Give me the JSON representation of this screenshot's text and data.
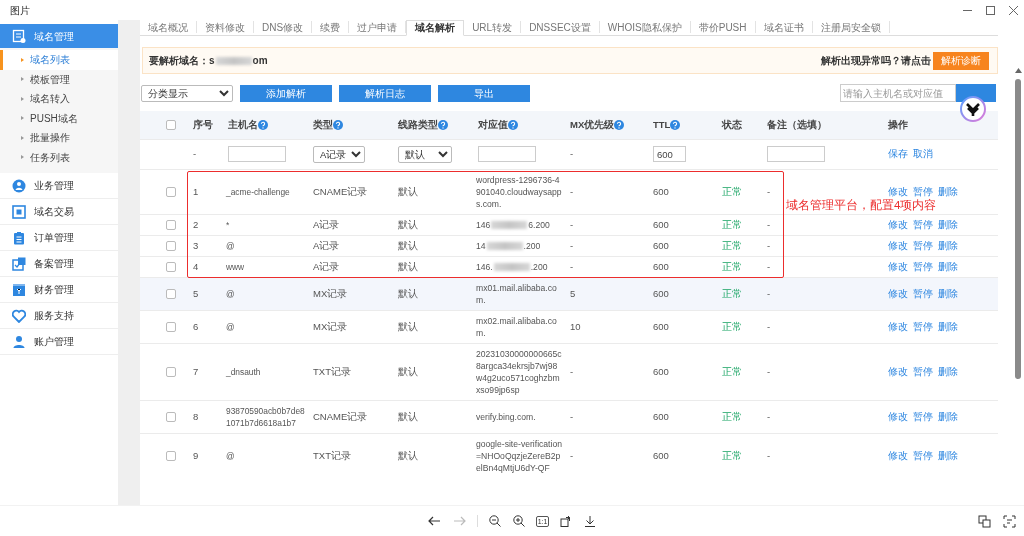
{
  "viewer": {
    "title": "图片",
    "zoom_reset": "1:1",
    "back_disabled": false,
    "forward_disabled": true
  },
  "sidebar": {
    "groups": [
      {
        "label": "域名管理",
        "expanded": true,
        "children": [
          {
            "label": "域名列表",
            "selected": true
          },
          {
            "label": "模板管理",
            "selected": false
          },
          {
            "label": "域名转入",
            "selected": false
          },
          {
            "label": "PUSH域名",
            "selected": false
          },
          {
            "label": "批量操作",
            "selected": false
          },
          {
            "label": "任务列表",
            "selected": false
          }
        ]
      },
      {
        "label": "业务管理",
        "expanded": false
      },
      {
        "label": "域名交易",
        "expanded": false
      },
      {
        "label": "订单管理",
        "expanded": false
      },
      {
        "label": "备案管理",
        "expanded": false
      },
      {
        "label": "财务管理",
        "expanded": false
      },
      {
        "label": "服务支持",
        "expanded": false
      },
      {
        "label": "账户管理",
        "expanded": false
      }
    ]
  },
  "tabs": [
    {
      "label": "域名概况",
      "selected": false
    },
    {
      "label": "资料修改",
      "selected": false
    },
    {
      "label": "DNS修改",
      "selected": false
    },
    {
      "label": "续费",
      "selected": false
    },
    {
      "label": "过户申请",
      "selected": false
    },
    {
      "label": "域名解析",
      "selected": true
    },
    {
      "label": "URL转发",
      "selected": false
    },
    {
      "label": "DNSSEC设置",
      "selected": false
    },
    {
      "label": "WHOIS隐私保护",
      "selected": false
    },
    {
      "label": "带价PUSH",
      "selected": false
    },
    {
      "label": "域名证书",
      "selected": false
    },
    {
      "label": "注册局安全锁",
      "selected": false
    }
  ],
  "notice": {
    "label": "要解析域名：",
    "domain_parts": [
      "s",
      "om"
    ],
    "hint": "解析出现异常吗？请点击",
    "button": "解析诊断"
  },
  "toolbar": {
    "filter": "分类显示",
    "buttons": [
      "添加解析",
      "解析日志",
      "导出"
    ],
    "search": {
      "placeholder": "请输入主机名或对应值"
    }
  },
  "table": {
    "select_all": {
      "checked": false
    },
    "columns": [
      {
        "label": "序号",
        "help": false
      },
      {
        "label": "主机名",
        "help": true
      },
      {
        "label": "类型",
        "help": true
      },
      {
        "label": "线路类型",
        "help": true
      },
      {
        "label": "对应值",
        "help": true
      },
      {
        "label": "MX优先级",
        "help": true
      },
      {
        "label": "TTL",
        "help": true
      },
      {
        "label": "状态",
        "help": false
      },
      {
        "label": "备注（选填）",
        "help": false
      },
      {
        "label": "操作",
        "help": false
      }
    ],
    "new_row": {
      "index": "-",
      "type": "A记录",
      "line": "默认",
      "mx": "-",
      "ttl": "600",
      "actions": [
        "保存",
        "取消"
      ]
    },
    "rows": [
      {
        "checked": false,
        "highlighted": false,
        "boxed": true,
        "index": "1",
        "host": "_acme-challenge",
        "type": "CNAME记录",
        "line": "默认",
        "value": "wordpress-1296736-4901040.cloudwaysapps.com.",
        "mx": "-",
        "ttl": "600",
        "status": "正常",
        "note": "-",
        "actions": [
          "修改",
          "暂停",
          "删除"
        ]
      },
      {
        "checked": false,
        "highlighted": false,
        "boxed": true,
        "index": "2",
        "host": "*",
        "type": "A记录",
        "line": "默认",
        "value_parts": [
          "146",
          "6.200"
        ],
        "mx": "-",
        "ttl": "600",
        "status": "正常",
        "note": "-",
        "actions": [
          "修改",
          "暂停",
          "删除"
        ]
      },
      {
        "checked": false,
        "highlighted": false,
        "boxed": true,
        "index": "3",
        "host": "@",
        "type": "A记录",
        "line": "默认",
        "value_parts": [
          "14",
          ".200"
        ],
        "mx": "-",
        "ttl": "600",
        "status": "正常",
        "note": "-",
        "actions": [
          "修改",
          "暂停",
          "删除"
        ]
      },
      {
        "checked": false,
        "highlighted": false,
        "boxed": true,
        "index": "4",
        "host": "www",
        "type": "A记录",
        "line": "默认",
        "value_parts": [
          "146.",
          ".200"
        ],
        "mx": "-",
        "ttl": "600",
        "status": "正常",
        "note": "-",
        "actions": [
          "修改",
          "暂停",
          "删除"
        ]
      },
      {
        "checked": false,
        "highlighted": true,
        "boxed": false,
        "index": "5",
        "host": "@",
        "type": "MX记录",
        "line": "默认",
        "value": "mx01.mail.alibaba.com.",
        "mx": "5",
        "ttl": "600",
        "status": "正常",
        "note": "-",
        "actions": [
          "修改",
          "暂停",
          "删除"
        ]
      },
      {
        "checked": false,
        "highlighted": false,
        "boxed": false,
        "index": "6",
        "host": "@",
        "type": "MX记录",
        "line": "默认",
        "value": "mx02.mail.alibaba.com.",
        "mx": "10",
        "ttl": "600",
        "status": "正常",
        "note": "-",
        "actions": [
          "修改",
          "暂停",
          "删除"
        ]
      },
      {
        "checked": false,
        "highlighted": false,
        "boxed": false,
        "index": "7",
        "host": "_dnsauth",
        "type": "TXT记录",
        "line": "默认",
        "value": "20231030000000665c8argca34ekrsjb7wj98w4g2uco571coghzbmxso99jp6sp",
        "mx": "-",
        "ttl": "600",
        "status": "正常",
        "note": "-",
        "actions": [
          "修改",
          "暂停",
          "删除"
        ]
      },
      {
        "checked": false,
        "highlighted": false,
        "boxed": false,
        "index": "8",
        "host": "93870590acb0b7de81071b7d6618a1b7",
        "type": "CNAME记录",
        "line": "默认",
        "value": "verify.bing.com.",
        "mx": "-",
        "ttl": "600",
        "status": "正常",
        "note": "-",
        "actions": [
          "修改",
          "暂停",
          "删除"
        ]
      },
      {
        "checked": false,
        "highlighted": false,
        "boxed": false,
        "index": "9",
        "host": "@",
        "type": "TXT记录",
        "line": "默认",
        "value": "google-site-verification=NHOoQqzjeZereB2pelBn4qMtjU6dY-QF",
        "mx": "-",
        "ttl": "600",
        "status": "正常",
        "note": "-",
        "actions": [
          "修改",
          "暂停",
          "删除"
        ]
      }
    ]
  },
  "annotation": {
    "text": "域名管理平台，配置4项内容"
  }
}
